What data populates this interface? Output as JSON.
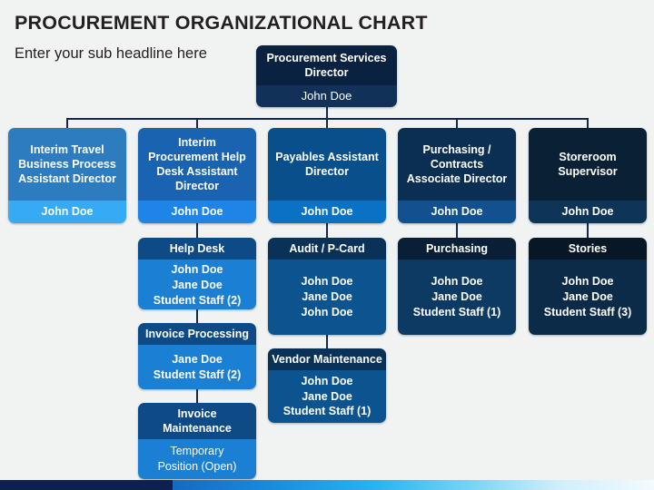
{
  "header": {
    "title": "PROCUREMENT ORGANIZATIONAL CHART",
    "subtitle": "Enter your sub headline here"
  },
  "colors": {
    "background": "#f1f2f2",
    "connector": "#13294b",
    "root_header": "#0a2240",
    "root_body": "#123158",
    "col1_header": "#2e7cc0",
    "col1_body": "#36aaf5",
    "col2_header": "#1a63b0",
    "col2_body": "#1f84e8",
    "col3_header": "#084f8c",
    "col3_body": "#0a72c4",
    "col4_header": "#0b2f52",
    "col4_body": "#12518e",
    "col5_header": "#0a2035",
    "col5_body": "#0e3457",
    "bottom_bar_navy": "#0d2050",
    "bottom_bar_cyan": "#2ab3ee"
  },
  "root": {
    "title": "Procurement\nServices Director",
    "title_line1": "Procurement",
    "title_line2": "Services Director",
    "name": "John Doe"
  },
  "columns": [
    {
      "id": "col1",
      "lead": {
        "title_line1": "Interim Travel",
        "title_line2": "Business Process",
        "title_line3": "Assistant Director",
        "name": "John Doe"
      },
      "children": []
    },
    {
      "id": "col2",
      "lead": {
        "title_line1": "Interim",
        "title_line2": "Procurement Help",
        "title_line3": "Desk Assistant",
        "title_line4": "Director",
        "name": "John Doe"
      },
      "children": [
        {
          "title": "Help Desk",
          "members": [
            "John Doe",
            "Jane Doe",
            "Student Staff (2)"
          ]
        },
        {
          "title": "Invoice Processing",
          "members": [
            "Jane Doe",
            "Student Staff (2)"
          ]
        },
        {
          "title_line1": "Invoice",
          "title_line2": "Maintenance",
          "members": [
            "Temporary",
            "Position (Open)"
          ]
        }
      ]
    },
    {
      "id": "col3",
      "lead": {
        "title_line1": "Payables",
        "title_line2": "Assistant",
        "title_line3": "Director",
        "name": "John Doe"
      },
      "children": [
        {
          "title": "Audit / P-Card",
          "members": [
            "John Doe",
            "Jane Doe",
            "John Doe"
          ]
        },
        {
          "title": "Vendor Maintenance",
          "members": [
            "John Doe",
            "Jane Doe",
            "Student Staff (1)"
          ]
        }
      ]
    },
    {
      "id": "col4",
      "lead": {
        "title_line1": "Purchasing /",
        "title_line2": "Contracts",
        "title_line3": "Associate Director",
        "name": "John Doe"
      },
      "children": [
        {
          "title": "Purchasing",
          "members": [
            "John Doe",
            "Jane Doe",
            "Student Staff (1)"
          ]
        }
      ]
    },
    {
      "id": "col5",
      "lead": {
        "title_line1": "Storeroom",
        "title_line2": "Supervisor",
        "name": "John Doe"
      },
      "children": [
        {
          "title": "Stories",
          "members": [
            "John Doe",
            "Jane Doe",
            "Student Staff (3)"
          ]
        }
      ]
    }
  ]
}
